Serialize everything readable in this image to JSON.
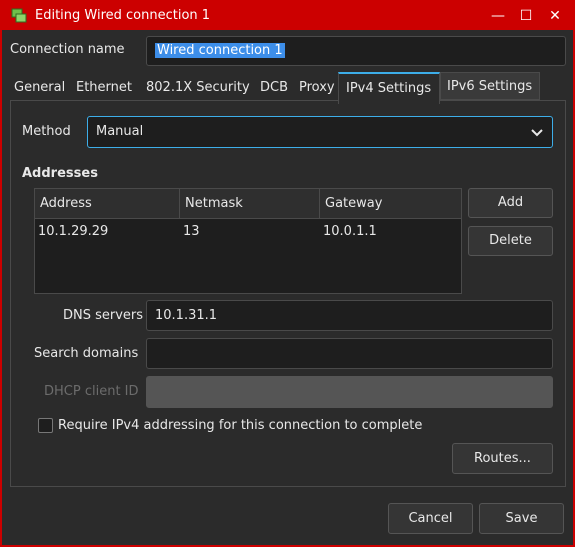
{
  "window": {
    "title": "Editing Wired connection 1"
  },
  "connection": {
    "label": "Connection name",
    "value": "Wired connection 1"
  },
  "tabs": [
    {
      "label": "General"
    },
    {
      "label": "Ethernet"
    },
    {
      "label": "802.1X Security"
    },
    {
      "label": "DCB"
    },
    {
      "label": "Proxy"
    },
    {
      "label": "IPv4 Settings",
      "active": true
    },
    {
      "label": "IPv6 Settings"
    }
  ],
  "ipv4": {
    "method_label": "Method",
    "method_value": "Manual",
    "addresses_heading": "Addresses",
    "columns": [
      "Address",
      "Netmask",
      "Gateway"
    ],
    "rows": [
      {
        "address": "10.1.29.29",
        "netmask": "13",
        "gateway": "10.0.1.1"
      }
    ],
    "add_label": "Add",
    "delete_label": "Delete",
    "dns_label": "DNS servers",
    "dns_value": "10.1.31.1",
    "search_label": "Search domains",
    "search_value": "",
    "dhcp_label": "DHCP client ID",
    "dhcp_value": "",
    "require_label": "Require IPv4 addressing for this connection to complete",
    "require_checked": false,
    "routes_label": "Routes..."
  },
  "footer": {
    "cancel_label": "Cancel",
    "save_label": "Save"
  },
  "colors": {
    "titlebar": "#cc0000",
    "background": "#2b2b2b",
    "accent": "#3daee9",
    "selection": "#3d8ee9"
  }
}
